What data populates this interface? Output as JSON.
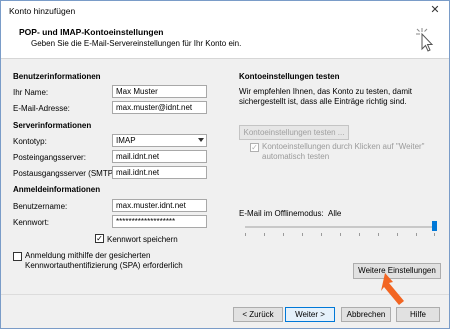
{
  "window": {
    "title": "Konto hinzufügen"
  },
  "header": {
    "title": "POP- und IMAP-Kontoeinstellungen",
    "subtitle": "Geben Sie die E-Mail-Servereinstellungen für Ihr Konto ein."
  },
  "user_info": {
    "section": "Benutzerinformationen",
    "name_label": "Ihr Name:",
    "name_value": "Max Muster",
    "email_label": "E-Mail-Adresse:",
    "email_value": "max.muster@idnt.net"
  },
  "server_info": {
    "section": "Serverinformationen",
    "account_type_label": "Kontotyp:",
    "account_type_value": "IMAP",
    "incoming_label": "Posteingangsserver:",
    "incoming_value": "mail.idnt.net",
    "outgoing_label": "Postausgangsserver (SMTP):",
    "outgoing_value": "mail.idnt.net"
  },
  "login_info": {
    "section": "Anmeldeinformationen",
    "username_label": "Benutzername:",
    "username_value": "max.muster.idnt.net",
    "password_label": "Kennwort:",
    "password_value": "*******************",
    "remember_label": "Kennwort speichern",
    "spa_label_line1": "Anmeldung mithilfe der gesicherten",
    "spa_label_line2": "Kennwortauthentifizierung (SPA) erforderlich"
  },
  "test": {
    "section": "Kontoeinstellungen testen",
    "desc_line1": "Wir empfehlen Ihnen, das Konto zu testen, damit",
    "desc_line2": "sichergestellt ist, dass alle Einträge richtig sind.",
    "button": "Kontoeinstellungen testen ...",
    "auto_line1": "Kontoeinstellungen durch Klicken auf \"Weiter\"",
    "auto_line2": "automatisch testen"
  },
  "offline": {
    "label": "E-Mail im Offlinemodus:",
    "value": "Alle",
    "level": 1.0
  },
  "more_settings": "Weitere Einstellungen",
  "footer": {
    "back": "< Zurück",
    "next": "Weiter >",
    "cancel": "Abbrechen",
    "help": "Hilfe"
  },
  "colors": {
    "accent": "#0078d7",
    "pointer": "#f26522"
  }
}
